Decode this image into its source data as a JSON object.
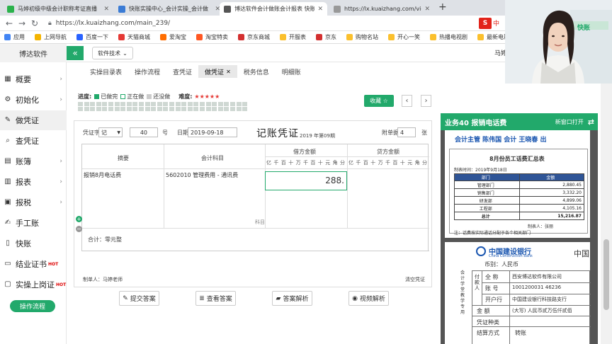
{
  "browser": {
    "tabs": [
      {
        "title": "马婷初级中级会计职称考证直播",
        "active": false,
        "color": "#2bb24c"
      },
      {
        "title": "快账实操中心_会计实操_会计做",
        "active": false,
        "color": "#3a7bd5"
      },
      {
        "title": "博达软件会计做账会计报表 快账",
        "active": true,
        "color": "#555555"
      },
      {
        "title": "https://lx.kuaizhang.com/view",
        "active": false,
        "color": "#999999"
      }
    ],
    "new_tab": "+",
    "url": "https://lx.kuaizhang.com/main_239/",
    "extension_label": "中",
    "bookmarks": [
      "应用",
      "上网导航",
      "百度一下",
      "天猫商城",
      "爱淘宝",
      "淘宝特卖",
      "京东商城",
      "开服表",
      "京东",
      "购物名站",
      "开心一笑",
      "热播电视剧",
      "最新电影"
    ]
  },
  "app": {
    "brand": "博达软件",
    "collapse_icon": "«",
    "tech_dropdown": "软件技术",
    "header_user": "马婷"
  },
  "sidebar": {
    "items": [
      {
        "label": "概要",
        "icon": "grid-icon",
        "arrow": "›"
      },
      {
        "label": "初始化",
        "icon": "gear-icon",
        "arrow": "›"
      },
      {
        "label": "做凭证",
        "icon": "pen-icon",
        "arrow": "",
        "active": true
      },
      {
        "label": "查凭证",
        "icon": "search-icon",
        "arrow": ""
      },
      {
        "label": "账簿",
        "icon": "book-icon",
        "arrow": "›"
      },
      {
        "label": "报表",
        "icon": "report-icon",
        "arrow": "›"
      },
      {
        "label": "报税",
        "icon": "tax-icon",
        "arrow": "›"
      },
      {
        "label": "手工账",
        "icon": "hand-pen-icon",
        "arrow": ""
      },
      {
        "label": "快账",
        "icon": "doc-icon",
        "arrow": ""
      },
      {
        "label": "结业证书",
        "icon": "certificate-icon",
        "arrow": "",
        "badge": "HOT"
      },
      {
        "label": "实操上岗证",
        "icon": "badge-icon",
        "arrow": "",
        "badge": "HOT"
      }
    ],
    "flow_button": "操作流程"
  },
  "page_tabs": [
    "实操目录表",
    "操作流程",
    "查凭证",
    "做凭证",
    "税务信息",
    "明细账"
  ],
  "active_page_tab": "做凭证",
  "progress": {
    "label": "进度:",
    "done": "已做完",
    "doing": "正在做",
    "todo": "还没做",
    "difficulty_label": "难度:",
    "stars": "★★★★★",
    "done_count": 40,
    "total": 56
  },
  "toolbar": {
    "collect": "收藏 ☆",
    "prev": "‹",
    "next": "›"
  },
  "voucher": {
    "word_label": "凭证字",
    "word": "记",
    "number": "40",
    "number_unit": "号",
    "date_label": "日期",
    "date": "2019-09-18",
    "title": "记账凭证",
    "period": "2019 年第09期",
    "attach_label": "附单据",
    "attach_count": "4",
    "attach_unit": "张",
    "col_summary": "摘要",
    "col_subject": "会计科目",
    "col_debit": "借方金额",
    "col_credit": "贷方金额",
    "digits": [
      "亿",
      "千",
      "百",
      "十",
      "万",
      "千",
      "百",
      "十",
      "元",
      "角",
      "分"
    ],
    "row_summary": "报销8月电话费",
    "row_subject": "5602010 管理费用 - 通讯费",
    "row_debit": "288.",
    "subject_placeholder": "科目",
    "total_label": "合计：零元整",
    "maker": "制单人：马婷老师",
    "clear": "清空凭证"
  },
  "actions": {
    "submit": "提交答案",
    "check": "查看答案",
    "explain": "答案解析",
    "video": "视频解析"
  },
  "right_panel": {
    "title": "业务40 报销电话费",
    "new_window": "新窗口打开",
    "switch_icon": "⇄"
  },
  "document": {
    "signatures": "会计主管  陈伟国      会计  王晓春      出",
    "table_title": "8月份员工话费汇总表",
    "table_date": "制表时间：2019年9月18日",
    "headers": [
      "部门",
      "金额"
    ],
    "rows": [
      [
        "管理部门",
        "2,880.45"
      ],
      [
        "销售部门",
        "3,332.20"
      ],
      [
        "研发部",
        "4,899.06"
      ],
      [
        "工程部",
        "4,105.16"
      ],
      [
        "总计",
        "15,216.87"
      ]
    ],
    "maker": "制表人：张丽",
    "note": "注：话费按实际通话分配于各个相关部门",
    "bank_name": "中国建设银行",
    "bank_en": "China Construction Bank",
    "bank_suffix": "中国",
    "currency": "币别：人民币",
    "vertical_side": "会计学堂教学专用",
    "payer_label": "付款人",
    "fields": [
      [
        "全 称",
        "西安博达软件有限公司"
      ],
      [
        "账 号",
        "1001200031 46236"
      ],
      [
        "开户行",
        "中国建设银行科技路支行"
      ]
    ],
    "amount_label": "金 额",
    "amount_value": "(大写) 人民币贰万伍仟贰佰",
    "voucher_type": "凭证种类",
    "settle_label": "结算方式",
    "settle_value": "转账"
  },
  "webcam": {
    "watermark": "快账"
  }
}
